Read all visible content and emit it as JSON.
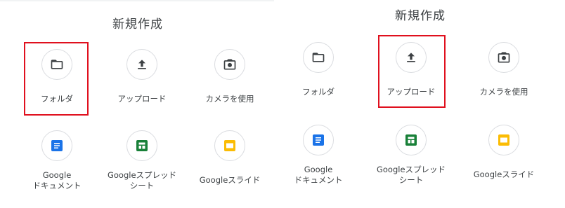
{
  "colors": {
    "highlight": "#e0101e",
    "docs_blue": "#1a73e8",
    "sheets_green": "#188038",
    "slides_yellow": "#fbbc04",
    "icon_gray": "#3c4043"
  },
  "left": {
    "title": "新規作成",
    "items": [
      {
        "label": "フォルダ",
        "icon": "folder-icon"
      },
      {
        "label": "アップロード",
        "icon": "upload-icon"
      },
      {
        "label": "カメラを使用",
        "icon": "camera-icon"
      },
      {
        "label": "Google\nドキュメント",
        "icon": "google-docs-icon"
      },
      {
        "label": "Googleスプレッド\nシート",
        "icon": "google-sheets-icon"
      },
      {
        "label": "Googleスライド",
        "icon": "google-slides-icon"
      }
    ],
    "highlighted": "フォルダ"
  },
  "right": {
    "title": "新規作成",
    "items": [
      {
        "label": "フォルダ",
        "icon": "folder-icon"
      },
      {
        "label": "アップロード",
        "icon": "upload-icon"
      },
      {
        "label": "カメラを使用",
        "icon": "camera-icon"
      },
      {
        "label": "Google\nドキュメント",
        "icon": "google-docs-icon"
      },
      {
        "label": "Googleスプレッド\nシート",
        "icon": "google-sheets-icon"
      },
      {
        "label": "Googleスライド",
        "icon": "google-slides-icon"
      }
    ],
    "highlighted": "アップロード"
  }
}
